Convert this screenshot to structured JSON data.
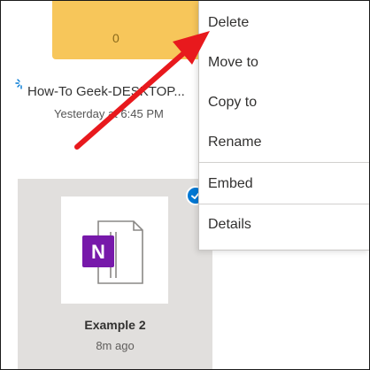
{
  "folder": {
    "count": "0",
    "name": "How-To Geek-DESKTOP...",
    "date": "Yesterday at 6:45 PM"
  },
  "file": {
    "name": "Example 2",
    "date": "8m ago",
    "app_letter": "N"
  },
  "menu": {
    "items": [
      "Delete",
      "Move to",
      "Copy to",
      "Rename",
      "Embed",
      "Details"
    ]
  },
  "colors": {
    "folder": "#f7c65a",
    "onenote": "#7719aa",
    "selection": "#0078d4",
    "annotation_arrow": "#e8191d"
  },
  "icons": {
    "sync": "sync-icon",
    "onenote": "onenote-file-icon",
    "check": "checkmark-icon"
  }
}
